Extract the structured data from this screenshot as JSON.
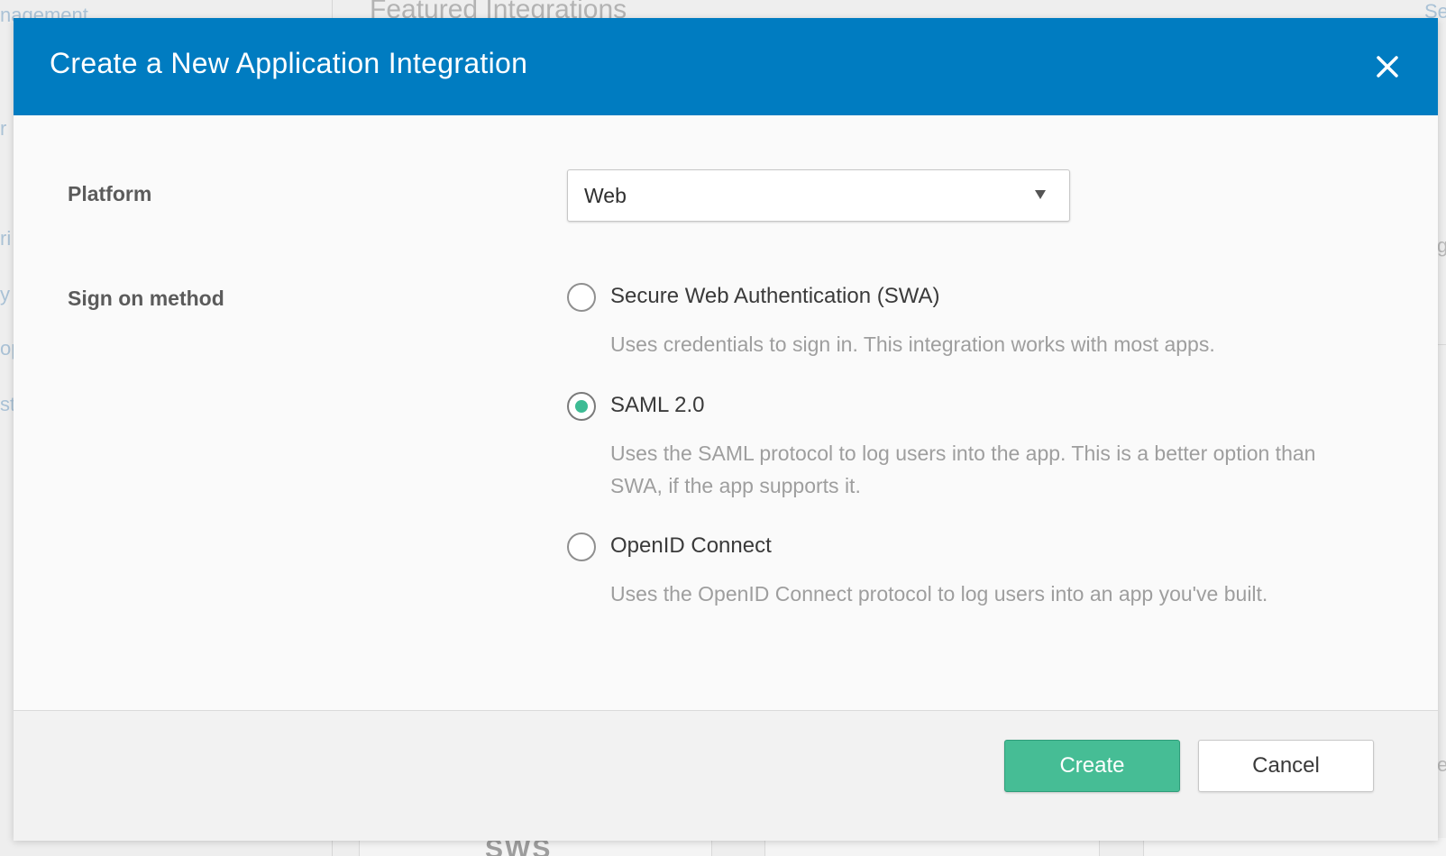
{
  "background": {
    "sidebar_top_text": "nagement",
    "featured_heading": "Featured Integrations",
    "right_top_text": "Se",
    "edge_fragments": [
      "r",
      "ri",
      "y A",
      "op",
      "st"
    ],
    "right_edge_fragments": [
      "g",
      "e"
    ],
    "card_logo_text": "SWS"
  },
  "modal": {
    "title": "Create a New Application Integration",
    "close_icon": "close-icon",
    "platform": {
      "label": "Platform",
      "selected_value": "Web"
    },
    "sign_on": {
      "label": "Sign on method",
      "selected_option": "SAML 2.0",
      "options": [
        {
          "label": "Secure Web Authentication (SWA)",
          "description": "Uses credentials to sign in. This integration works with most apps."
        },
        {
          "label": "SAML 2.0",
          "description": "Uses the SAML protocol to log users into the app. This is a better option than SWA, if the app supports it."
        },
        {
          "label": "OpenID Connect",
          "description": "Uses the OpenID Connect protocol to log users into an app you've built."
        }
      ]
    },
    "footer": {
      "create_label": "Create",
      "cancel_label": "Cancel"
    }
  },
  "colors": {
    "header_blue": "#007cc1",
    "create_green": "#46bd95",
    "radio_selected": "#3dbb94"
  }
}
